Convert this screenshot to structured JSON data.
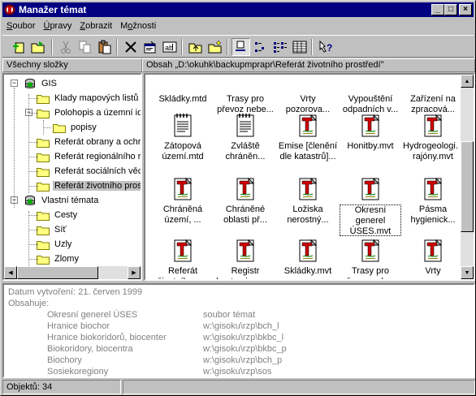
{
  "window": {
    "title": "Manažer témat",
    "buttons": [
      "_",
      "□",
      "×"
    ]
  },
  "menu": [
    {
      "label": "Soubor",
      "u": 0
    },
    {
      "label": "Úpravy",
      "u": 0
    },
    {
      "label": "Zobrazit",
      "u": 0
    },
    {
      "label": "Možnosti",
      "u": 1
    }
  ],
  "panes": {
    "left_header": "Všechny složky",
    "right_header": "Obsah „D:\\okuhk\\backupmprapr\\Referát životního prostředí\""
  },
  "tree": [
    {
      "label": "GIS",
      "icon": "database-icon",
      "expander": "−",
      "level": 0
    },
    {
      "label": "Klady mapových listů",
      "icon": "folder-icon",
      "level": 1
    },
    {
      "label": "Polohopis a územní ide",
      "icon": "folder-icon",
      "expander": "−",
      "level": 1
    },
    {
      "label": "popisy",
      "icon": "folder-icon",
      "level": 2
    },
    {
      "label": "Referát obrany a ochra",
      "icon": "folder-icon",
      "level": 1
    },
    {
      "label": "Referát regionálního ro",
      "icon": "folder-icon",
      "level": 1
    },
    {
      "label": "Referát sociálních věc",
      "icon": "folder-icon",
      "level": 1
    },
    {
      "label": "Referát životního prost",
      "icon": "folder-icon",
      "level": 1,
      "selected": true
    },
    {
      "label": "Vlastní témata",
      "icon": "database-icon",
      "expander": "−",
      "level": 0
    },
    {
      "label": "Cesty",
      "icon": "folder-icon",
      "level": 1
    },
    {
      "label": "Síť",
      "icon": "folder-icon",
      "level": 1
    },
    {
      "label": "Uzly",
      "icon": "folder-icon",
      "level": 1
    },
    {
      "label": "Zlomy",
      "icon": "folder-icon",
      "level": 1
    }
  ],
  "files": [
    {
      "caption": "Skládky.mtd",
      "icon": "notepad-icon"
    },
    {
      "caption": "Trasy pro převoz nebe...",
      "icon": "notepad-icon"
    },
    {
      "caption": "Vrty pozorova...",
      "icon": "notepad-icon"
    },
    {
      "caption": "Vypouštění odpadních v...",
      "icon": "notepad-icon"
    },
    {
      "caption": "Zařízení na zpracová...",
      "icon": "notepad-icon"
    },
    {
      "caption": "Zátopová území.mtd",
      "icon": "notepad-icon"
    },
    {
      "caption": "Zvláště chráněn...",
      "icon": "notepad-icon"
    },
    {
      "caption": "Emise [členění dle katastrů]...",
      "icon": "theme-t-icon"
    },
    {
      "caption": "Honitby.mvt",
      "icon": "theme-t-icon"
    },
    {
      "caption": "Hydrogeologi... rajóny.mvt",
      "icon": "theme-t-icon"
    },
    {
      "caption": "Chráněná území, ...",
      "icon": "theme-t-icon"
    },
    {
      "caption": "Chráněné oblasti př...",
      "icon": "theme-t-icon"
    },
    {
      "caption": "Ložiska nerostný...",
      "icon": "theme-t-icon"
    },
    {
      "caption": "Okresní generel ÚSES.mvt",
      "icon": "theme-t-icon",
      "focused": true
    },
    {
      "caption": "Pásma hygienick...",
      "icon": "theme-t-icon"
    },
    {
      "caption": "Referát životního p...",
      "icon": "theme-t-icon"
    },
    {
      "caption": "Registr kontaminova...",
      "icon": "theme-t-icon"
    },
    {
      "caption": "Skládky.mvt",
      "icon": "theme-t-icon"
    },
    {
      "caption": "Trasy pro převoz nebe...",
      "icon": "theme-t-icon"
    },
    {
      "caption": "Vrty pozorova...",
      "icon": "theme-t-icon"
    }
  ],
  "info": {
    "created": "Datum vytvoření: 21. červen 1999",
    "contains_label": "Obsahuje:",
    "rows": [
      {
        "name": "Okresní generel ÚSES",
        "path": "soubor témat"
      },
      {
        "name": "Hranice biochor",
        "path": "w:\\gisoku\\rzp\\bch_l"
      },
      {
        "name": "Hranice biokoridorů, biocenter",
        "path": "w:\\gisoku\\rzp\\bkbc_l"
      },
      {
        "name": "Biokoridory, biocentra",
        "path": "w:\\gisoku\\rzp\\bkbc_p"
      },
      {
        "name": "Biochory",
        "path": "w:\\gisoku\\rzp\\bch_p"
      },
      {
        "name": "Sosiekoregiony",
        "path": "w:\\gisoku\\rzp\\sos"
      }
    ]
  },
  "status": {
    "count": "Objektů: 34"
  },
  "toolbar": [
    {
      "name": "new-theme-icon"
    },
    {
      "name": "open-folder-icon"
    },
    {
      "name": "cut-icon",
      "disabled": true
    },
    {
      "name": "copy-icon",
      "disabled": true
    },
    {
      "name": "paste-icon"
    },
    {
      "name": "delete-icon"
    },
    {
      "name": "properties-icon"
    },
    {
      "name": "rename-icon"
    },
    {
      "name": "up-folder-icon"
    },
    {
      "name": "new-folder-icon"
    },
    {
      "name": "large-icons-icon",
      "pressed": true
    },
    {
      "name": "small-icons-icon"
    },
    {
      "name": "list-icon"
    },
    {
      "name": "details-icon"
    },
    {
      "name": "help-icon"
    }
  ],
  "colors": {
    "titlebar": "#000080",
    "theme_icon_red": "#cc0000",
    "folder": "#ffff80"
  }
}
